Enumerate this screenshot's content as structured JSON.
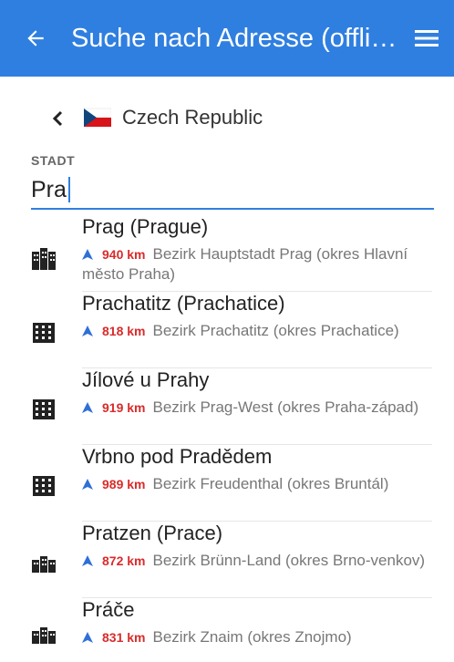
{
  "appbar": {
    "title": "Suche nach Adresse (offli…",
    "back_icon": "arrow-left-icon",
    "menu_icon": "hamburger-menu-icon",
    "color": "#2f7fe0"
  },
  "breadcrumb": {
    "country": "Czech Republic",
    "back_icon": "chevron-left-icon",
    "flag_icon": "czech-flag-icon"
  },
  "search": {
    "label": "STADT",
    "value": "Pra"
  },
  "results": [
    {
      "name": "Prag (Prague)",
      "distance": "940 km",
      "region": "Bezirk Hauptstadt Prag (okres Hlavní město Praha)",
      "icon": "large-city-icon"
    },
    {
      "name": "Prachatitz (Prachatice)",
      "distance": "818 km",
      "region": "Bezirk Prachatitz (okres Prachatice)",
      "icon": "city-icon"
    },
    {
      "name": "Jílové u Prahy",
      "distance": "919 km",
      "region": "Bezirk Prag-West (okres Praha-západ)",
      "icon": "city-icon"
    },
    {
      "name": "Vrbno pod Pradědem",
      "distance": "989 km",
      "region": "Bezirk Freudenthal (okres Bruntál)",
      "icon": "city-icon"
    },
    {
      "name": "Pratzen (Prace)",
      "distance": "872 km",
      "region": "Bezirk Brünn-Land (okres Brno-venkov)",
      "icon": "town-icon"
    },
    {
      "name": "Práče",
      "distance": "831 km",
      "region": "Bezirk Znaim (okres Znojmo)",
      "icon": "town-icon"
    }
  ],
  "colors": {
    "distance": "#d92b2b",
    "direction_arrow": "#2f6fd6"
  }
}
